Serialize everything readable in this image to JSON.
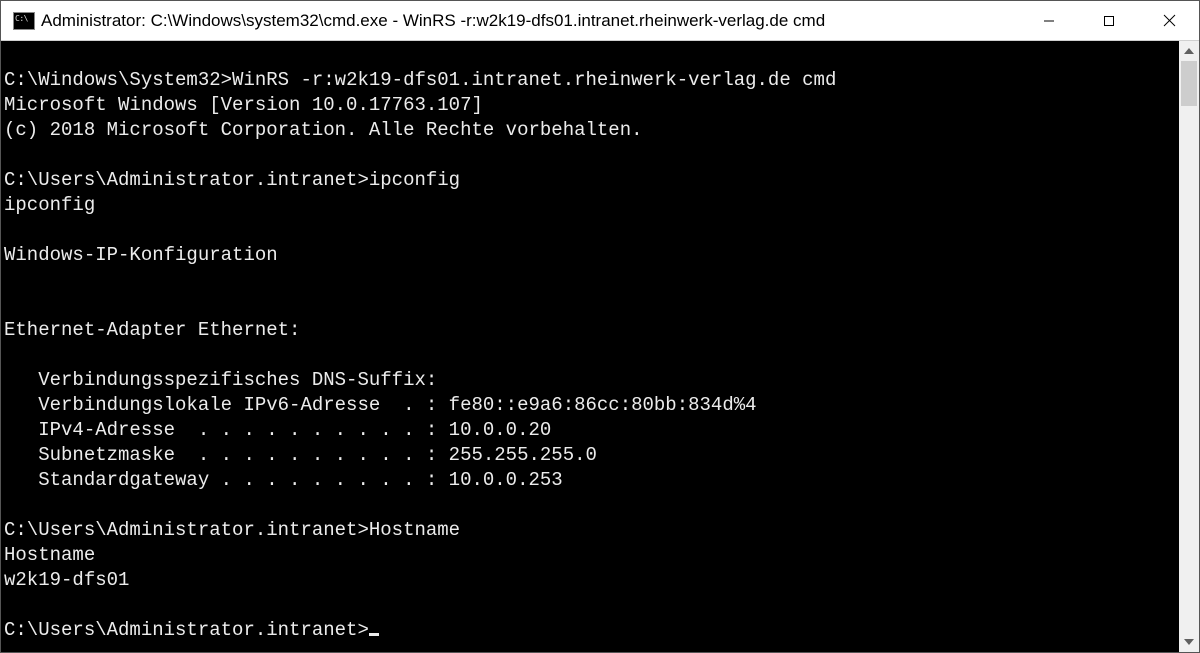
{
  "window": {
    "title": "Administrator: C:\\Windows\\system32\\cmd.exe - WinRS  -r:w2k19-dfs01.intranet.rheinwerk-verlag.de cmd"
  },
  "terminal": {
    "line1_prompt": "C:\\Windows\\System32>",
    "line1_cmd": "WinRS -r:w2k19-dfs01.intranet.rheinwerk-verlag.de cmd",
    "line2": "Microsoft Windows [Version 10.0.17763.107]",
    "line3": "(c) 2018 Microsoft Corporation. Alle Rechte vorbehalten.",
    "line5_prompt": "C:\\Users\\Administrator.intranet>",
    "line5_cmd": "ipconfig",
    "line6": "ipconfig",
    "line8": "Windows-IP-Konfiguration",
    "line11": "Ethernet-Adapter Ethernet:",
    "line13": "   Verbindungsspezifisches DNS-Suffix:",
    "line14": "   Verbindungslokale IPv6-Adresse  . : fe80::e9a6:86cc:80bb:834d%4",
    "line15": "   IPv4-Adresse  . . . . . . . . . . : 10.0.0.20",
    "line16": "   Subnetzmaske  . . . . . . . . . . : 255.255.255.0",
    "line17": "   Standardgateway . . . . . . . . . : 10.0.0.253",
    "line19_prompt": "C:\\Users\\Administrator.intranet>",
    "line19_cmd": "Hostname",
    "line20": "Hostname",
    "line21": "w2k19-dfs01",
    "line23_prompt": "C:\\Users\\Administrator.intranet>"
  }
}
